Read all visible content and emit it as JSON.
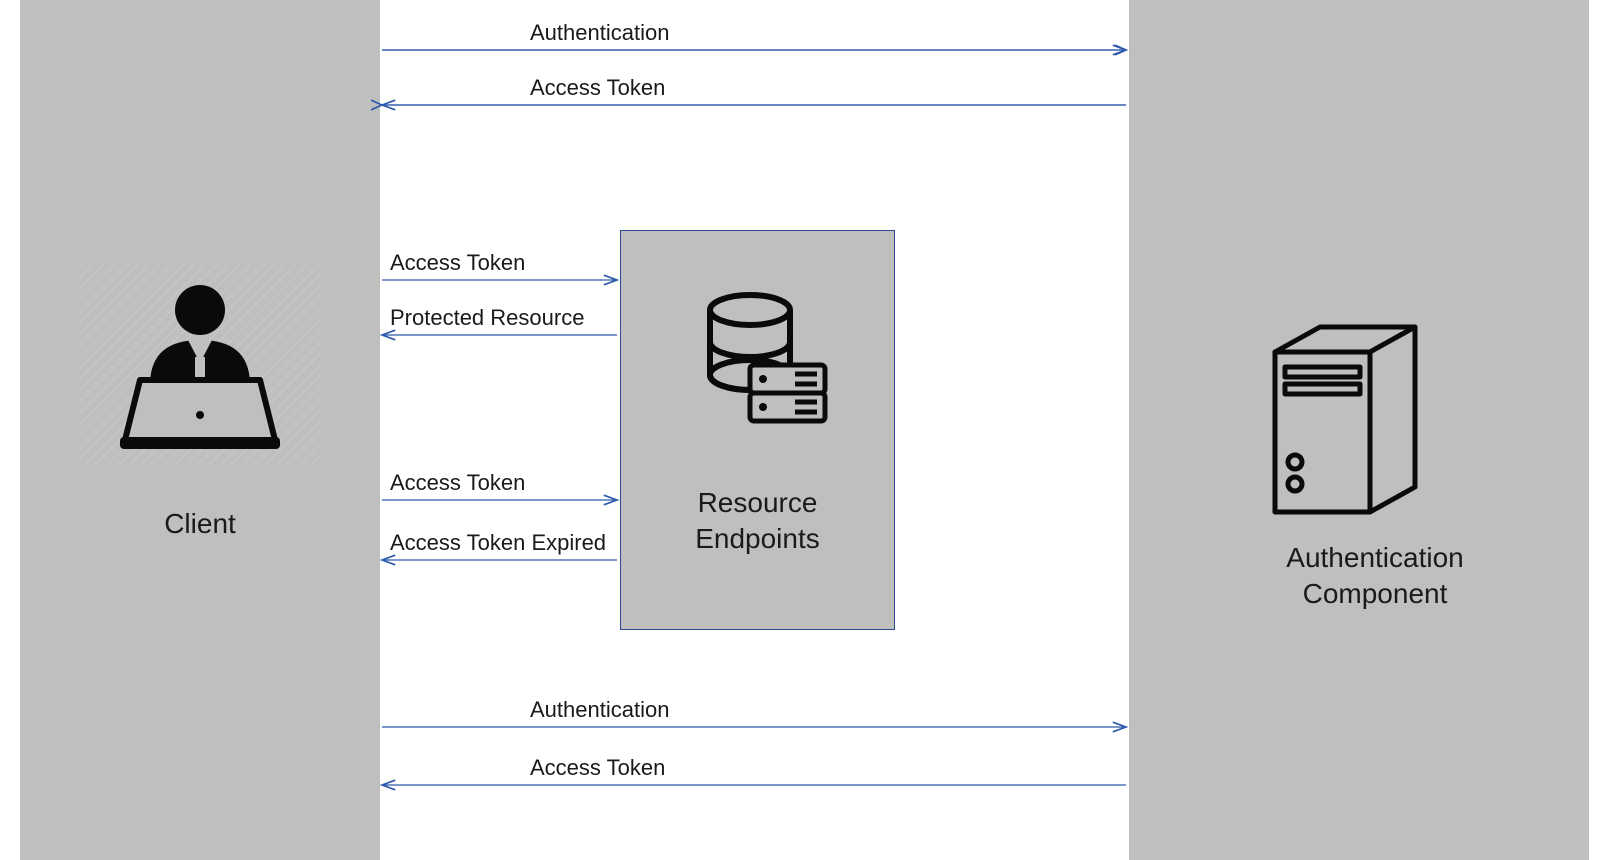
{
  "entities": {
    "client": {
      "label": "Client"
    },
    "resource": {
      "label_line1": "Resource",
      "label_line2": "Endpoints"
    },
    "auth": {
      "label_line1": "Authentication",
      "label_line2": "Component"
    }
  },
  "messages": {
    "auth1_req": "Authentication",
    "auth1_resp": "Access Token",
    "res1_req": "Access Token",
    "res1_resp": "Protected Resource",
    "res2_req": "Access Token",
    "res2_resp": "Access Token Expired",
    "auth2_req": "Authentication",
    "auth2_resp": "Access Token"
  },
  "icons": {
    "client": "user-laptop-icon",
    "resource": "database-server-icon",
    "auth": "server-tower-icon"
  }
}
